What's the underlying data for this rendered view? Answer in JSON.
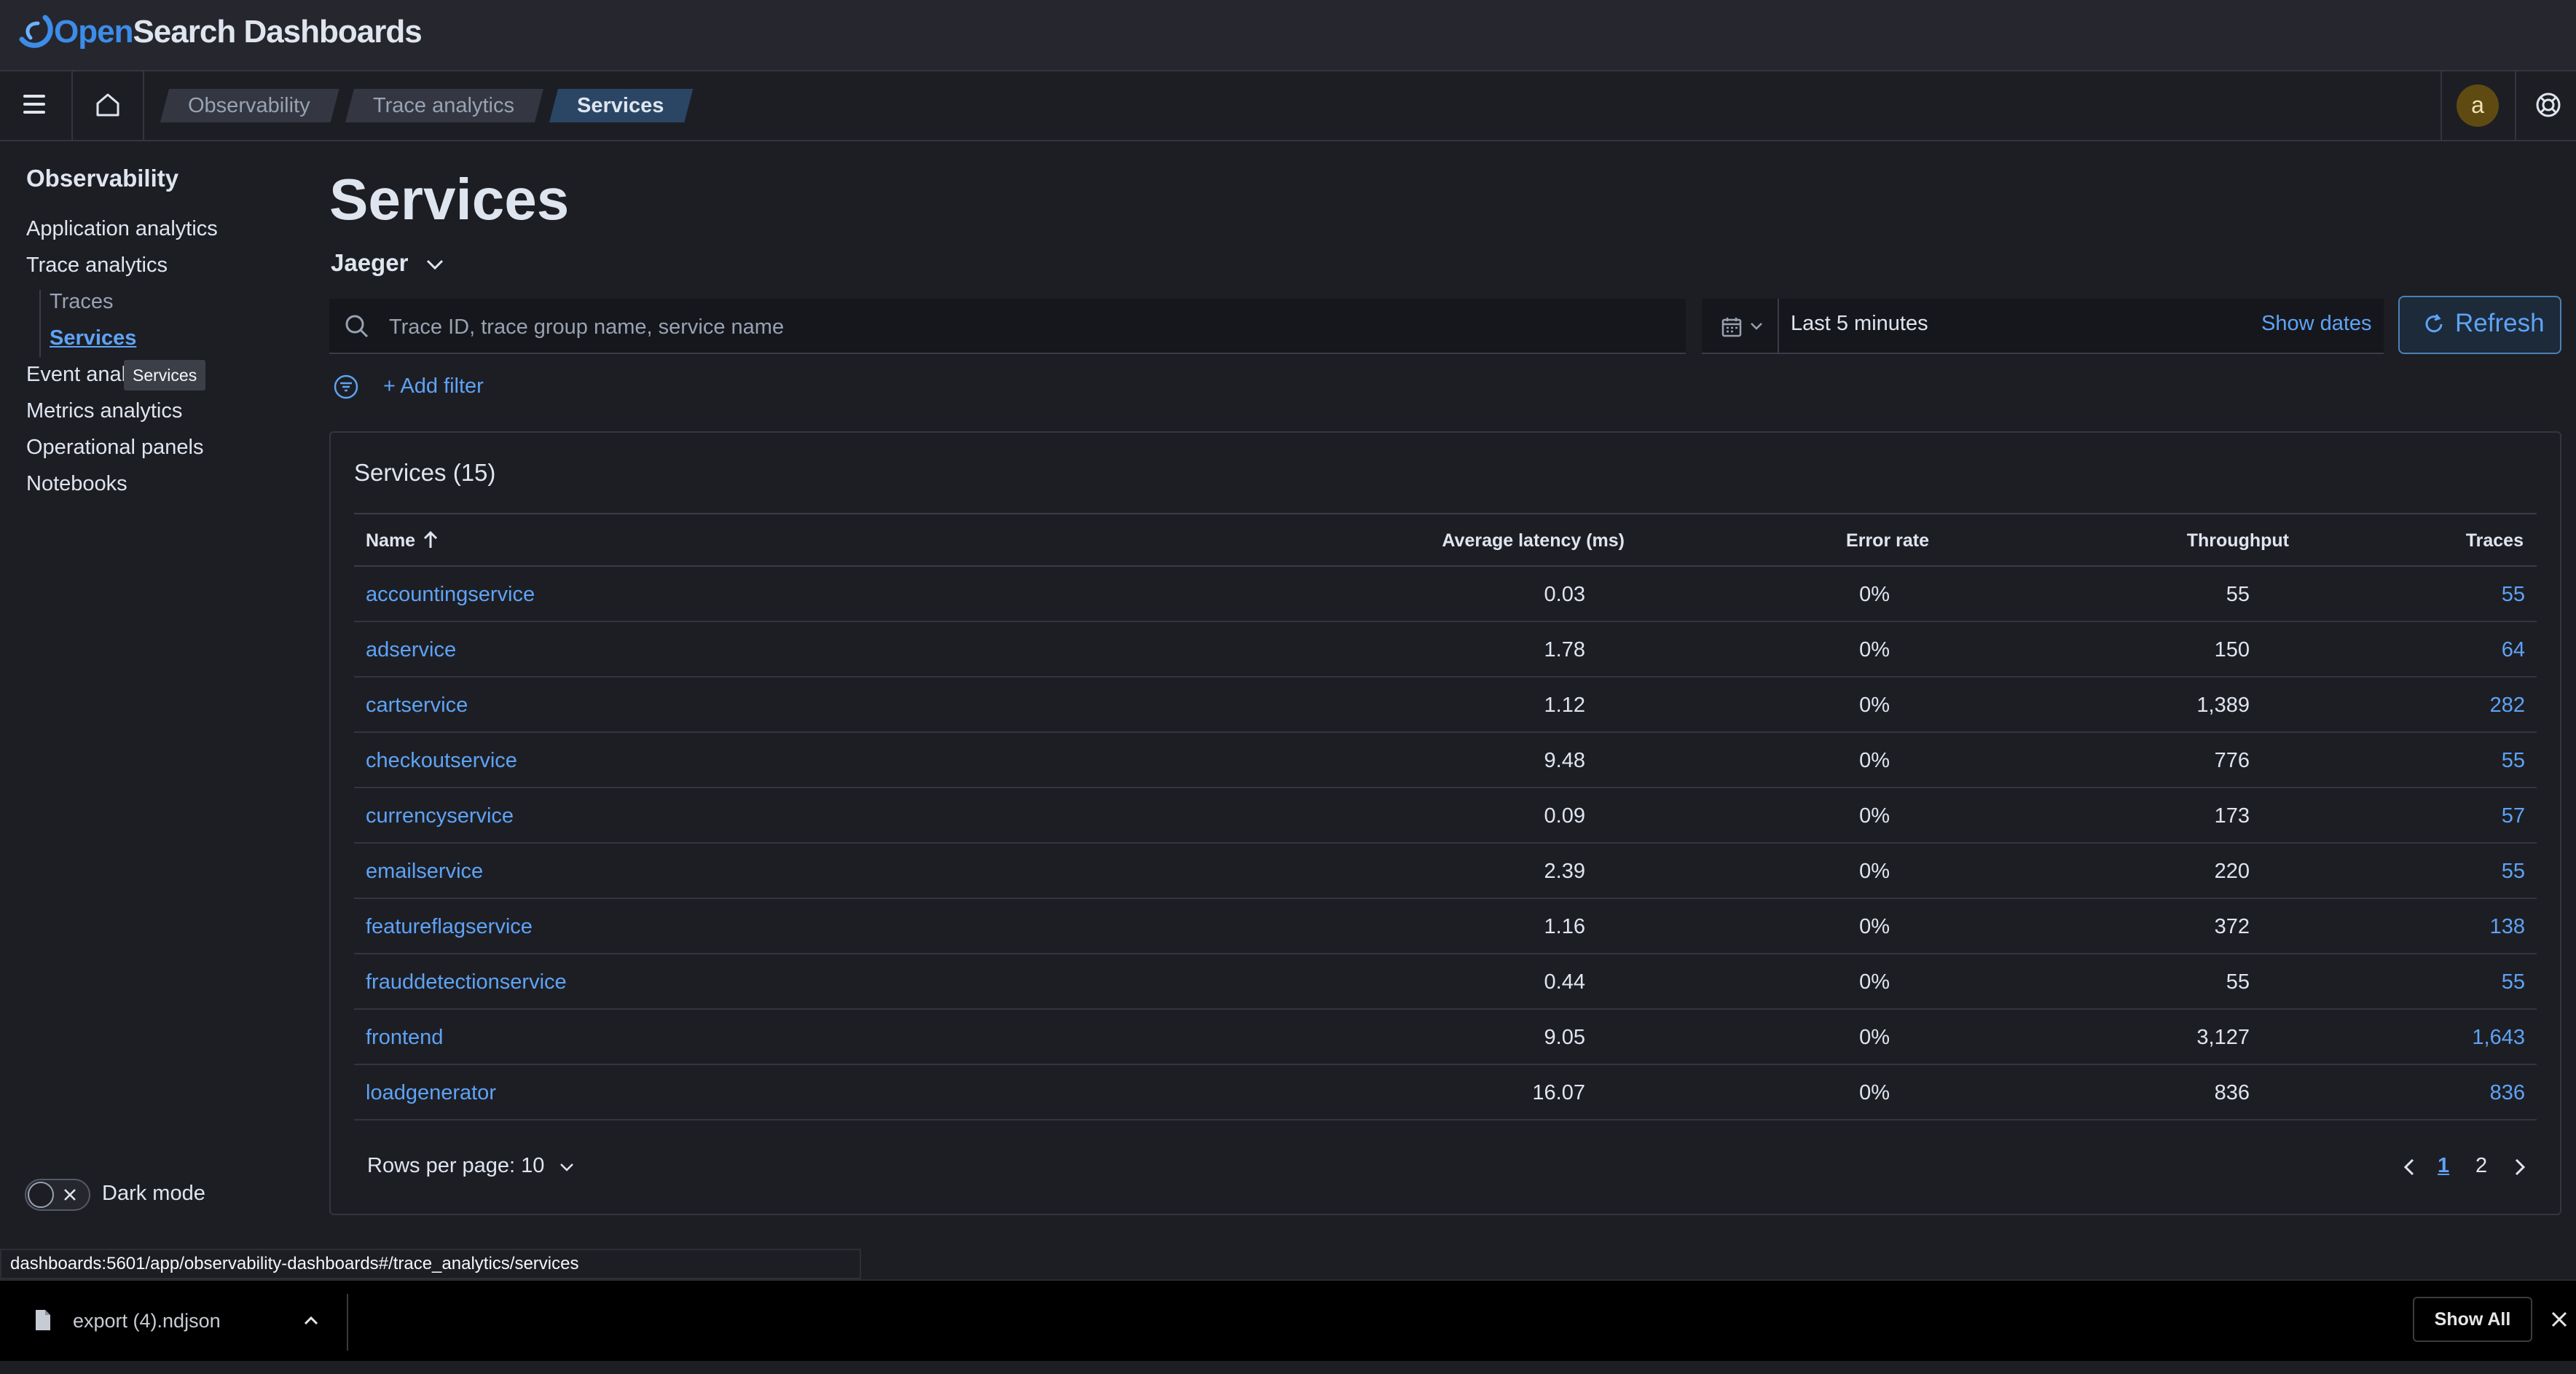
{
  "app": {
    "logo_open": "Open",
    "logo_rest": "Search Dashboards"
  },
  "breadcrumbs": [
    "Observability",
    "Trace analytics",
    "Services"
  ],
  "user": {
    "avatar_initial": "a"
  },
  "sidebar": {
    "title": "Observability",
    "items": [
      {
        "label": "Application analytics"
      },
      {
        "label": "Trace analytics"
      },
      {
        "label": "Event anal"
      },
      {
        "label": "Metrics analytics"
      },
      {
        "label": "Operational panels"
      },
      {
        "label": "Notebooks"
      }
    ],
    "sub_items": [
      {
        "label": "Traces"
      },
      {
        "label": "Services"
      }
    ],
    "tooltip": "Services",
    "dark_mode_label": "Dark mode"
  },
  "main": {
    "title": "Services",
    "source": "Jaeger",
    "search_placeholder": "Trace ID, trace group name, service name",
    "date_range": "Last 5 minutes",
    "show_dates": "Show dates",
    "refresh": "Refresh",
    "add_filter": "+ Add filter"
  },
  "table": {
    "title": "Services",
    "count": "(15)",
    "columns": [
      "Name",
      "Average latency (ms)",
      "Error rate",
      "Throughput",
      "Traces"
    ],
    "rows": [
      {
        "name": "accountingservice",
        "latency": "0.03",
        "error": "0%",
        "throughput": "55",
        "traces": "55"
      },
      {
        "name": "adservice",
        "latency": "1.78",
        "error": "0%",
        "throughput": "150",
        "traces": "64"
      },
      {
        "name": "cartservice",
        "latency": "1.12",
        "error": "0%",
        "throughput": "1,389",
        "traces": "282"
      },
      {
        "name": "checkoutservice",
        "latency": "9.48",
        "error": "0%",
        "throughput": "776",
        "traces": "55"
      },
      {
        "name": "currencyservice",
        "latency": "0.09",
        "error": "0%",
        "throughput": "173",
        "traces": "57"
      },
      {
        "name": "emailservice",
        "latency": "2.39",
        "error": "0%",
        "throughput": "220",
        "traces": "55"
      },
      {
        "name": "featureflagservice",
        "latency": "1.16",
        "error": "0%",
        "throughput": "372",
        "traces": "138"
      },
      {
        "name": "frauddetectionservice",
        "latency": "0.44",
        "error": "0%",
        "throughput": "55",
        "traces": "55"
      },
      {
        "name": "frontend",
        "latency": "9.05",
        "error": "0%",
        "throughput": "3,127",
        "traces": "1,643"
      },
      {
        "name": "loadgenerator",
        "latency": "16.07",
        "error": "0%",
        "throughput": "836",
        "traces": "836"
      }
    ],
    "rows_per_page": "Rows per page: 10",
    "pages": [
      "1",
      "2"
    ],
    "current_page": "1"
  },
  "status_url": "dashboards:5601/app/observability-dashboards#/trace_analytics/services",
  "download": {
    "file_name": "export (4).ndjson",
    "show_all": "Show All"
  },
  "colors": {
    "background": "#1d1e24",
    "link": "#5ea3f5",
    "accent_brand": "#3d8ce8"
  }
}
